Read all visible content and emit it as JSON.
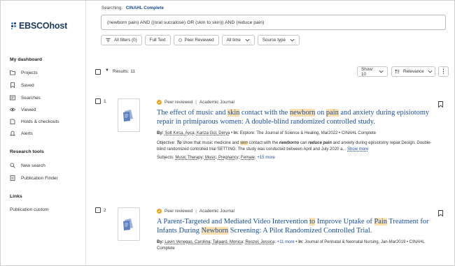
{
  "sidebar": {
    "logo_text": "EBSCOhost",
    "dashboard_heading": "My dashboard",
    "dashboard_items": [
      {
        "label": "Projects",
        "icon": "folder-icon"
      },
      {
        "label": "Saved",
        "icon": "bookmark-icon"
      },
      {
        "label": "Searches",
        "icon": "searches-icon"
      },
      {
        "label": "Viewed",
        "icon": "eye-icon"
      },
      {
        "label": "Holds & checkouts",
        "icon": "book-icon"
      },
      {
        "label": "Alerts",
        "icon": "bell-icon"
      }
    ],
    "research_heading": "Research tools",
    "research_items": [
      {
        "label": "New search",
        "icon": "search-icon"
      },
      {
        "label": "Publication Finder",
        "icon": "document-icon"
      }
    ],
    "links_heading": "Links",
    "links_items": [
      {
        "label": "Publication custom"
      }
    ]
  },
  "search": {
    "searching_label": "Searching:",
    "database": "CINAHL Complete",
    "query": "(newborn pain) AND ((oral sucralose) OR (skin to skin)) AND (reduce pain)"
  },
  "filters": {
    "all_filters": "All filters (0)",
    "full_text": "Full Text",
    "peer_reviewed": "Peer Reviewed",
    "all_time": "All time",
    "source_type": "Source type"
  },
  "results_bar": {
    "count": "Results: 11",
    "show": "Show: 10",
    "sort": "Relevance"
  },
  "results": [
    {
      "index": "1",
      "peer": "Peer reviewed",
      "type": "Academic Journal",
      "title_parts": [
        "The effect of music and ",
        "skin",
        " contact with the ",
        "newborn",
        " on ",
        "pain",
        " and anxiety during episiotomy repair in primiparous women: A double-blind randomized controlled study."
      ],
      "by_label": "By:",
      "authors": [
        "Solt Kırca, Ayça",
        "Kanza Gül, Derya"
      ],
      "in_label": "In:",
      "source": "Explore: The Journal of Science & Healing, Mar2022",
      "database": "CINAHL Complete",
      "abstract_parts": [
        "Objective: ",
        "To",
        " show that music medicine and ",
        "skin",
        " contact with the ",
        "newborns",
        " can ",
        "reduce pain",
        " and anxiety during episiotomy repair.Design: Double-blind randomized controlled trial SETTING: The study was conducted between April and July 2020 a... "
      ],
      "show_more": "Show more",
      "subjects_label": "Subjects:",
      "subjects": [
        "Music Therapy",
        "Music",
        "Pregnancy",
        "Female"
      ],
      "more_subjects": "+15 more"
    },
    {
      "index": "2",
      "peer": "Peer reviewed",
      "type": "Academic Journal",
      "title_parts": [
        "A Parent-Targeted and Mediated Video Intervention ",
        "to",
        " Improve Uptake of ",
        "Pain",
        " Treatment for Infants During ",
        "Newborn",
        " Screening: A Pilot Randomized Controlled Trial."
      ],
      "by_label": "By:",
      "authors": [
        "Lavin Venegas, Carolina",
        "Taljaard, Monica",
        "Reszel, Jessica"
      ],
      "more_authors": "+11 more",
      "in_label": "In:",
      "source": "Journal of Perinatal & Neonatal Nursing, Jan-Mar2019",
      "database": "CINAHL Complete"
    }
  ],
  "colors": {
    "link": "#1a4f9c",
    "highlight": "#fbe0ad",
    "peer_badge": "#e8a317"
  }
}
